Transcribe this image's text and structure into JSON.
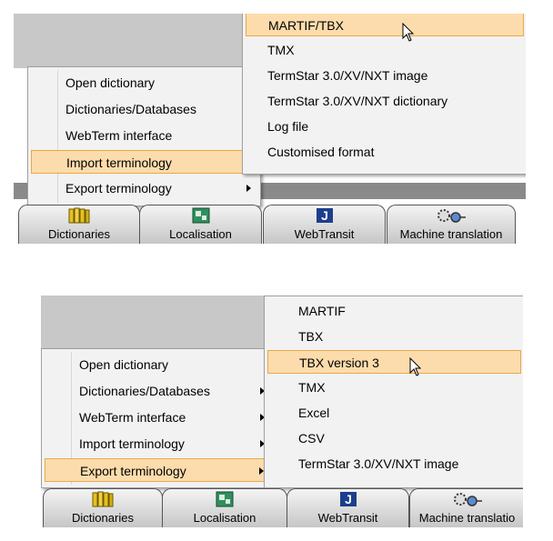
{
  "colors": {
    "highlight_bg": "#fcdcac",
    "highlight_border": "#e9a84a",
    "menu_bg": "#f2f2f2",
    "gray_backdrop": "#c8c8c8"
  },
  "screenshot1": {
    "main_menu": [
      {
        "label": "Open dictionary",
        "submenu": false
      },
      {
        "label": "Dictionaries/Databases",
        "submenu": true
      },
      {
        "label": "WebTerm interface",
        "submenu": true
      },
      {
        "label": "Import terminology",
        "submenu": true,
        "highlighted": true
      },
      {
        "label": "Export terminology",
        "submenu": true
      }
    ],
    "submenu": [
      {
        "label": "MARTIF/TBX",
        "highlighted": true
      },
      {
        "label": "TMX"
      },
      {
        "label": "TermStar 3.0/XV/NXT image"
      },
      {
        "label": "TermStar 3.0/XV/NXT dictionary"
      },
      {
        "label": "Log file"
      },
      {
        "label": "Customised format"
      }
    ],
    "tabs": [
      {
        "label": "Dictionaries",
        "icon": "books-icon",
        "active": true
      },
      {
        "label": "Localisation",
        "icon": "localisation-icon"
      },
      {
        "label": "WebTransit",
        "icon": "j-letter-icon"
      },
      {
        "label": "Machine translation",
        "icon": "gears-icon"
      }
    ]
  },
  "screenshot2": {
    "main_menu": [
      {
        "label": "Open dictionary",
        "submenu": false
      },
      {
        "label": "Dictionaries/Databases",
        "submenu": true
      },
      {
        "label": "WebTerm interface",
        "submenu": true
      },
      {
        "label": "Import terminology",
        "submenu": true
      },
      {
        "label": "Export terminology",
        "submenu": true,
        "highlighted": true
      }
    ],
    "submenu": [
      {
        "label": "MARTIF"
      },
      {
        "label": "TBX"
      },
      {
        "label": "TBX version 3",
        "highlighted": true
      },
      {
        "label": "TMX"
      },
      {
        "label": "Excel"
      },
      {
        "label": "CSV"
      },
      {
        "label": "TermStar 3.0/XV/NXT image"
      }
    ],
    "tabs": [
      {
        "label": "Dictionaries",
        "icon": "books-icon",
        "active": true
      },
      {
        "label": "Localisation",
        "icon": "localisation-icon"
      },
      {
        "label": "WebTransit",
        "icon": "j-letter-icon"
      },
      {
        "label": "Machine translatio",
        "icon": "gears-icon"
      }
    ]
  }
}
